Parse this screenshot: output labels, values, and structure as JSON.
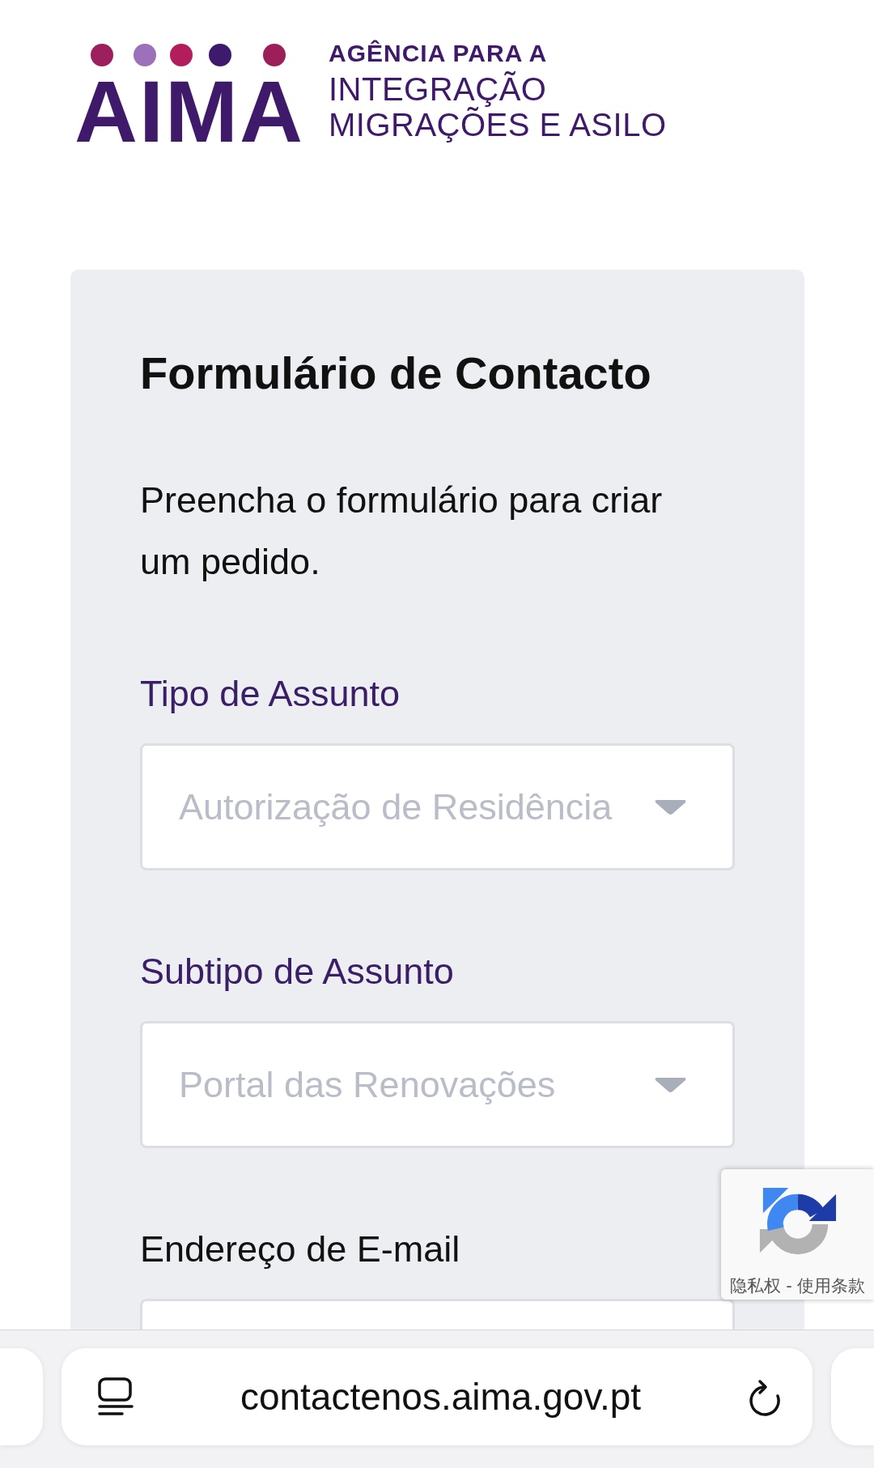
{
  "logo": {
    "wordmark": "AIMA",
    "agency_line": "AGÊNCIA PARA A",
    "name_lines": [
      "INTEGRAÇÃO",
      "MIGRAÇÕES E ASILO"
    ]
  },
  "form": {
    "title": "Formulário de Contacto",
    "description": "Preencha o formulário para criar um pedido.",
    "fields": [
      {
        "kind": "select",
        "label": "Tipo de Assunto",
        "value": "Autorização de Residência",
        "disabled": true
      },
      {
        "kind": "select",
        "label": "Subtipo de Assunto",
        "value": "Portal das Renovações",
        "disabled": true
      },
      {
        "kind": "email",
        "label": "Endereço de E-mail",
        "disabled": false
      }
    ]
  },
  "captcha": {
    "privacy_link": "隐私权",
    "separator": "-",
    "terms_link": "使用条款"
  },
  "browser_bar": {
    "url": "contactenos.aima.gov.pt"
  }
}
